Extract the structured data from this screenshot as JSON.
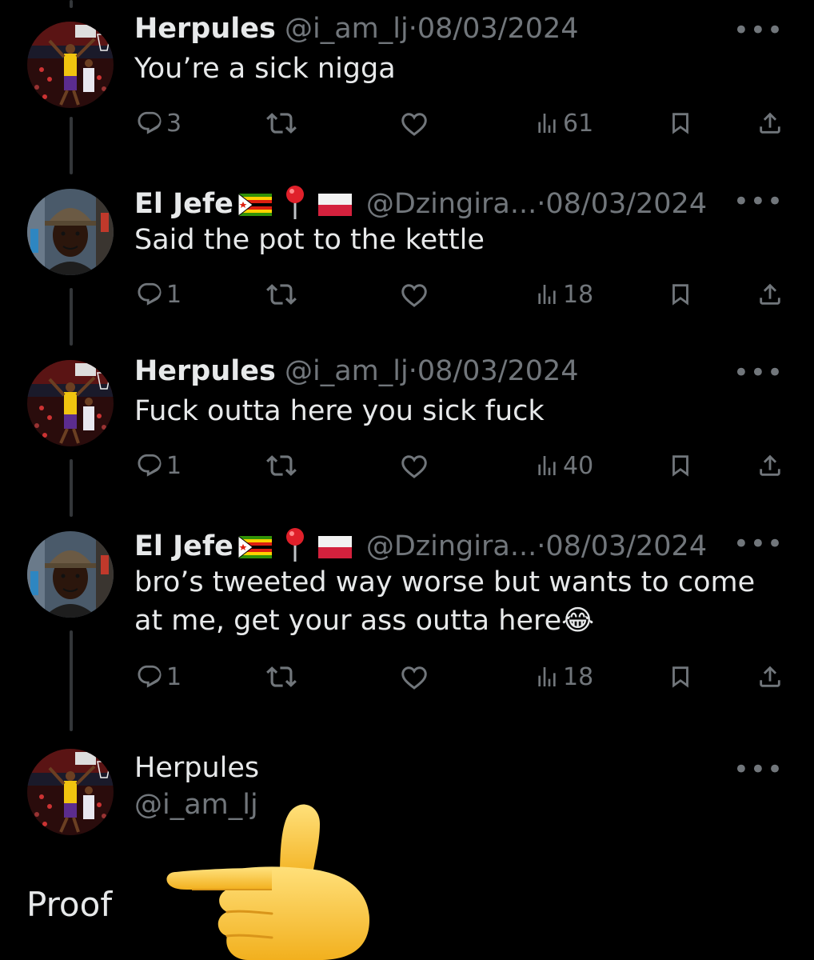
{
  "tweets": [
    {
      "name": "Herpules",
      "handle": "@i_am_lj",
      "sep": "·",
      "date": "08/03/2024",
      "text": "You’re a sick nigga",
      "replies": "3",
      "views": "61"
    },
    {
      "name": "El Jefe",
      "handle": "@Dzingira...",
      "sep": "·",
      "date": "08/03/2024",
      "text": "Said the pot to the kettle",
      "replies": "1",
      "views": "18"
    },
    {
      "name": "Herpules",
      "handle": "@i_am_lj",
      "sep": "·",
      "date": "08/03/2024",
      "text": "Fuck outta here you sick fuck",
      "replies": "1",
      "views": "40"
    },
    {
      "name": "El Jefe",
      "handle": "@Dzingira...",
      "sep": "·",
      "date": "08/03/2024",
      "text_line1": "bro’s tweeted way worse but wants to come",
      "text_line2": "at me, get your ass outta here",
      "emoji": "😂",
      "replies": "1",
      "views": "18"
    }
  ],
  "final_tweet": {
    "name": "Herpules",
    "handle": "@i_am_lj"
  },
  "caption": "Proof",
  "more_glyph": "•••",
  "colors": {
    "background": "#000000",
    "text": "#e7e9ea",
    "muted": "#71767b",
    "thread_line": "#333639",
    "hand": "#f7c52a"
  },
  "icons": [
    "reply-icon",
    "retweet-icon",
    "like-icon",
    "views-icon",
    "bookmark-icon",
    "share-icon",
    "more-icon",
    "zimbabwe-flag-icon",
    "pin-icon",
    "poland-flag-icon",
    "pointing-hand-icon"
  ]
}
